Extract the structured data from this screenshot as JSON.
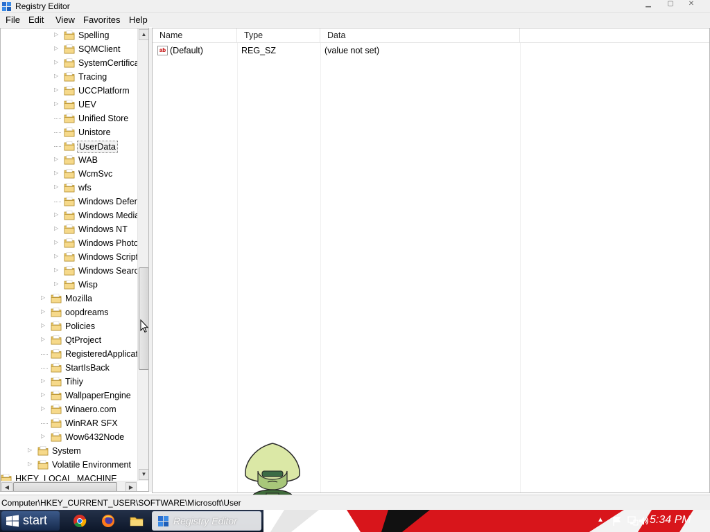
{
  "window": {
    "title": "Registry Editor",
    "controls": {
      "minimize": "▁",
      "maximize": "▢",
      "close": "✕"
    }
  },
  "menu": [
    "File",
    "Edit",
    "View",
    "Favorites",
    "Help"
  ],
  "tree": {
    "items": [
      {
        "label": "Spelling",
        "level": 2,
        "expandable": true
      },
      {
        "label": "SQMClient",
        "level": 2,
        "expandable": true
      },
      {
        "label": "SystemCertificates",
        "level": 2,
        "expandable": true
      },
      {
        "label": "Tracing",
        "level": 2,
        "expandable": true
      },
      {
        "label": "UCCPlatform",
        "level": 2,
        "expandable": true
      },
      {
        "label": "UEV",
        "level": 2,
        "expandable": true
      },
      {
        "label": "Unified Store",
        "level": 2,
        "expandable": false
      },
      {
        "label": "Unistore",
        "level": 2,
        "expandable": false
      },
      {
        "label": "UserData",
        "level": 2,
        "expandable": false,
        "selected": true
      },
      {
        "label": "WAB",
        "level": 2,
        "expandable": true
      },
      {
        "label": "WcmSvc",
        "level": 2,
        "expandable": true
      },
      {
        "label": "wfs",
        "level": 2,
        "expandable": true
      },
      {
        "label": "Windows Defender",
        "level": 2,
        "expandable": false
      },
      {
        "label": "Windows Media",
        "level": 2,
        "expandable": true
      },
      {
        "label": "Windows NT",
        "level": 2,
        "expandable": true
      },
      {
        "label": "Windows Photo Viewer",
        "level": 2,
        "expandable": true
      },
      {
        "label": "Windows Script Host",
        "level": 2,
        "expandable": true
      },
      {
        "label": "Windows Search",
        "level": 2,
        "expandable": true
      },
      {
        "label": "Wisp",
        "level": 2,
        "expandable": true
      },
      {
        "label": "Mozilla",
        "level": 1,
        "expandable": true
      },
      {
        "label": "oopdreams",
        "level": 1,
        "expandable": true
      },
      {
        "label": "Policies",
        "level": 1,
        "expandable": true
      },
      {
        "label": "QtProject",
        "level": 1,
        "expandable": true
      },
      {
        "label": "RegisteredApplications",
        "level": 1,
        "expandable": false
      },
      {
        "label": "StartIsBack",
        "level": 1,
        "expandable": false
      },
      {
        "label": "Tihiy",
        "level": 1,
        "expandable": true
      },
      {
        "label": "WallpaperEngine",
        "level": 1,
        "expandable": true
      },
      {
        "label": "Winaero.com",
        "level": 1,
        "expandable": true
      },
      {
        "label": "WinRAR SFX",
        "level": 1,
        "expandable": false
      },
      {
        "label": "Wow6432Node",
        "level": 1,
        "expandable": true
      },
      {
        "label": "System",
        "level": 0,
        "expandable": true
      },
      {
        "label": "Volatile Environment",
        "level": 0,
        "expandable": true
      },
      {
        "label": "HKEY_LOCAL_MACHINE",
        "level": -1,
        "expandable": true
      }
    ]
  },
  "values": {
    "columns": [
      "Name",
      "Type",
      "Data"
    ],
    "rows": [
      {
        "icon": "ab",
        "name": "(Default)",
        "type": "REG_SZ",
        "data": "(value not set)"
      }
    ]
  },
  "statusbar": {
    "path": "Computer\\HKEY_CURRENT_USER\\SOFTWARE\\Microsoft\\User"
  },
  "taskbar": {
    "start_label": "start",
    "task_label": "Registry Editor",
    "clock": "5:34 PM",
    "tray_chevron": "▲"
  },
  "colors": {
    "folder": "#e8c35a",
    "taskbar": "#1a2740",
    "accent_red": "#d8151b"
  }
}
